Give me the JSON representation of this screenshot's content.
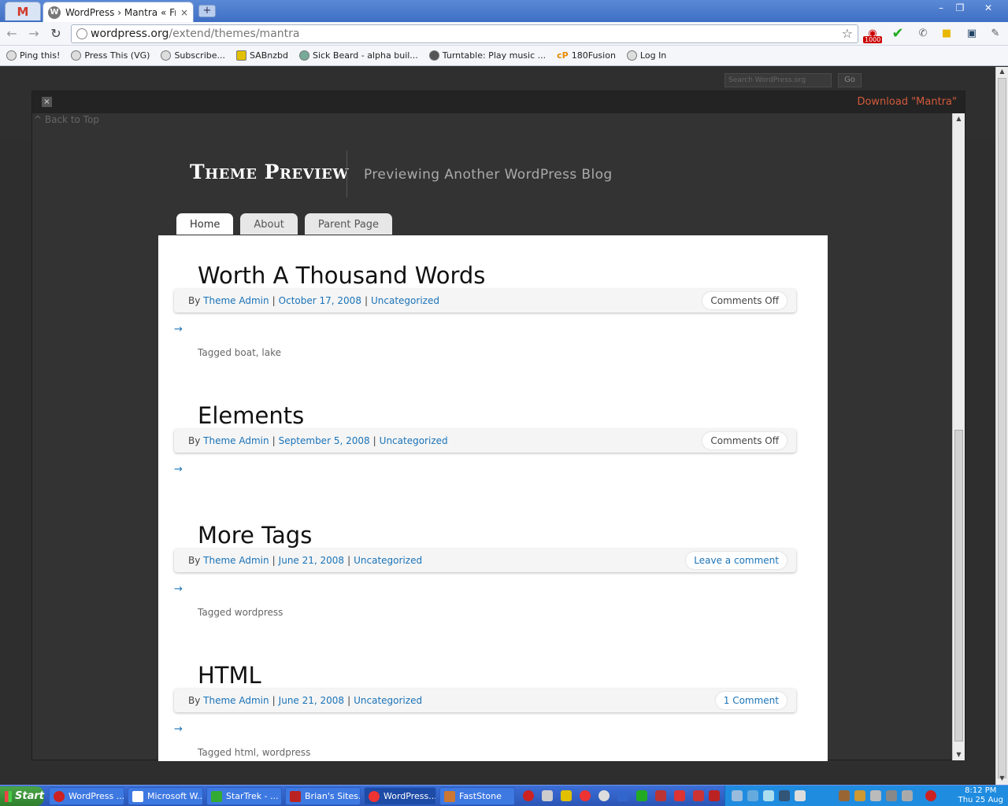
{
  "browser": {
    "gmail_tab_label": "M",
    "active_tab_title": "WordPress › Mantra « Free W",
    "tab_close": "×",
    "new_tab": "+",
    "url_domain": "wordpress.org",
    "url_path": "/extend/themes/mantra",
    "extension_badge": "1000",
    "window_controls": [
      "–",
      "❐",
      "✕"
    ]
  },
  "bookmarks": [
    "Ping this!",
    "Press This (VG)",
    "Subscribe...",
    "SABnzbd",
    "Sick Beard - alpha buil...",
    "Turntable: Play music ...",
    "180Fusion",
    "Log In"
  ],
  "wp": {
    "search_placeholder": "Search WordPress.org",
    "go_label": "Go"
  },
  "modal": {
    "close": "×",
    "download_label": "Download \"Mantra\"",
    "back_to_top": "^ Back to Top"
  },
  "theme": {
    "site_title": "Theme Preview",
    "site_description": "Previewing Another WordPress Blog",
    "menu": [
      "Home",
      "About",
      "Parent Page"
    ]
  },
  "posts": [
    {
      "title": "Worth A Thousand Words",
      "by": "By",
      "author": "Theme Admin",
      "date": "October 17, 2008",
      "category": "Uncategorized",
      "comments": "Comments Off",
      "arrow": "→",
      "tags_label": "Tagged",
      "tags": "boat, lake"
    },
    {
      "title": "Elements",
      "by": "By",
      "author": "Theme Admin",
      "date": "September 5, 2008",
      "category": "Uncategorized",
      "comments": "Comments Off",
      "arrow": "→",
      "tags_label": "",
      "tags": ""
    },
    {
      "title": "More Tags",
      "by": "By",
      "author": "Theme Admin",
      "date": "June 21, 2008",
      "category": "Uncategorized",
      "comments": "Leave a comment",
      "arrow": "→",
      "tags_label": "Tagged",
      "tags": "wordpress"
    },
    {
      "title": "HTML",
      "by": "By",
      "author": "Theme Admin",
      "date": "June 21, 2008",
      "category": "Uncategorized",
      "comments": "1 Comment",
      "arrow": "→",
      "tags_label": "Tagged",
      "tags": "html, wordpress"
    }
  ],
  "taskbar": {
    "start": "Start",
    "tasks": [
      "WordPress ...",
      "Microsoft W...",
      "StarTrek - ...",
      "Brian's Sites...",
      "WordPress...",
      "FastStone"
    ],
    "time": "8:12 PM",
    "date": "Thu 25 Aug"
  }
}
